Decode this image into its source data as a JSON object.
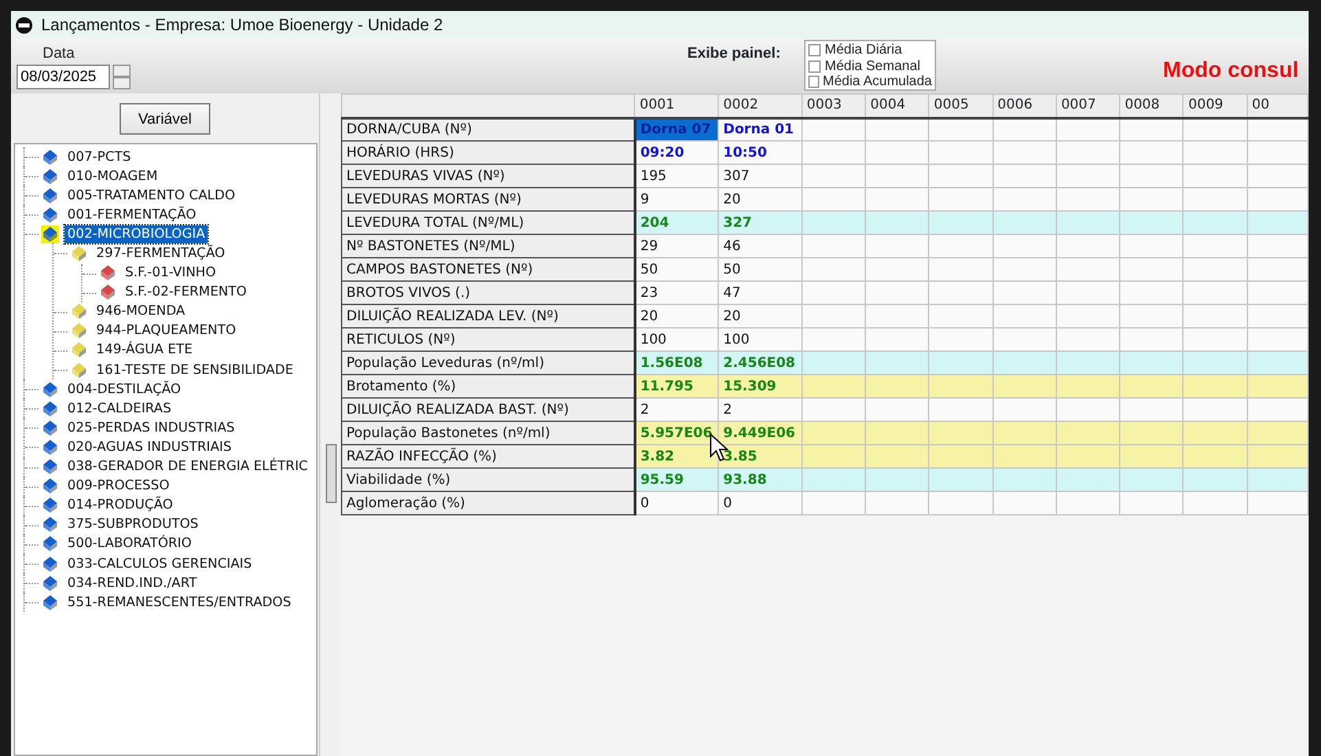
{
  "window": {
    "title": "Lançamentos  -  Empresa: Umoe Bioenergy - Unidade 2"
  },
  "toolbar": {
    "date_label": "Data",
    "date_value": "08/03/2025",
    "panel_label": "Exibe painel:",
    "panels": [
      {
        "label": "Média Diária",
        "checked": false
      },
      {
        "label": "Média Semanal",
        "checked": false
      },
      {
        "label": "Média Acumulada",
        "checked": false
      }
    ],
    "mode": "Modo consul"
  },
  "sidebar": {
    "button": "Variável",
    "items": [
      {
        "label": "007-PCTS",
        "color": "#1560d0",
        "selected": false
      },
      {
        "label": "010-MOAGEM",
        "color": "#1560d0",
        "selected": false
      },
      {
        "label": "005-TRATAMENTO CALDO",
        "color": "#1560d0",
        "selected": false
      },
      {
        "label": "001-FERMENTAÇÃO",
        "color": "#1560d0",
        "selected": false
      },
      {
        "label": "002-MICROBIOLOGIA",
        "color": "#1560d0",
        "selected": true,
        "children": [
          {
            "label": "297-FERMENTAÇÃO",
            "color": "#e2d64a",
            "selected": false,
            "children": [
              {
                "label": "S.F.-01-VINHO",
                "color": "#d84848",
                "selected": false
              },
              {
                "label": "S.F.-02-FERMENTO",
                "color": "#d84848",
                "selected": false
              }
            ]
          },
          {
            "label": "946-MOENDA",
            "color": "#e2d64a",
            "selected": false
          },
          {
            "label": "944-PLAQUEAMENTO",
            "color": "#e2d64a",
            "selected": false
          },
          {
            "label": "149-ÁGUA ETE",
            "color": "#e2d64a",
            "selected": false
          },
          {
            "label": "161-TESTE DE SENSIBILIDADE",
            "color": "#e2d64a",
            "selected": false
          }
        ]
      },
      {
        "label": "004-DESTILAÇÃO",
        "color": "#1560d0",
        "selected": false
      },
      {
        "label": "012-CALDEIRAS",
        "color": "#1560d0",
        "selected": false
      },
      {
        "label": "025-PERDAS INDUSTRIAS",
        "color": "#1560d0",
        "selected": false
      },
      {
        "label": "020-AGUAS INDUSTRIAIS",
        "color": "#1560d0",
        "selected": false
      },
      {
        "label": "038-GERADOR DE ENERGIA ELÉTRIC",
        "color": "#1560d0",
        "selected": false
      },
      {
        "label": "009-PROCESSO",
        "color": "#1560d0",
        "selected": false
      },
      {
        "label": "014-PRODUÇÃO",
        "color": "#1560d0",
        "selected": false
      },
      {
        "label": "375-SUBPRODUTOS",
        "color": "#1560d0",
        "selected": false
      },
      {
        "label": "500-LABORATÓRIO",
        "color": "#1560d0",
        "selected": false
      },
      {
        "label": "033-CALCULOS GERENCIAIS",
        "color": "#1560d0",
        "selected": false
      },
      {
        "label": "034-REND.IND./ART",
        "color": "#1560d0",
        "selected": false
      },
      {
        "label": "551-REMANESCENTES/ENTRADOS",
        "color": "#1560d0",
        "selected": false
      }
    ]
  },
  "table": {
    "columns": [
      "0001",
      "0002",
      "0003",
      "0004",
      "0005",
      "0006",
      "0007",
      "0008",
      "0009",
      "00"
    ],
    "rows": [
      {
        "label": "DORNA/CUBA (Nº)",
        "kind": "info",
        "values": [
          {
            "text": "Dorna 07",
            "selected": true
          },
          {
            "text": "Dorna 01",
            "selected": false
          }
        ]
      },
      {
        "label": "HORÁRIO (HRS)",
        "kind": "info",
        "values": [
          {
            "text": "09:20",
            "selected": false
          },
          {
            "text": "10:50",
            "selected": false
          }
        ]
      },
      {
        "label": "LEVEDURAS VIVAS (Nº)",
        "kind": "input",
        "values": [
          {
            "text": "195",
            "selected": false
          },
          {
            "text": "307",
            "selected": false
          }
        ]
      },
      {
        "label": "LEVEDURAS MORTAS (Nº)",
        "kind": "input",
        "values": [
          {
            "text": "9",
            "selected": false
          },
          {
            "text": "20",
            "selected": false
          }
        ]
      },
      {
        "label": "LEVEDURA TOTAL (Nº/ML)",
        "kind": "total",
        "values": [
          {
            "text": "204",
            "selected": false
          },
          {
            "text": "327",
            "selected": false
          }
        ]
      },
      {
        "label": "Nº BASTONETES (Nº/ML)",
        "kind": "input",
        "values": [
          {
            "text": "29",
            "selected": false
          },
          {
            "text": "46",
            "selected": false
          }
        ]
      },
      {
        "label": "CAMPOS BASTONETES (Nº)",
        "kind": "input",
        "values": [
          {
            "text": "50",
            "selected": false
          },
          {
            "text": "50",
            "selected": false
          }
        ]
      },
      {
        "label": "BROTOS VIVOS (.)",
        "kind": "input",
        "values": [
          {
            "text": "23",
            "selected": false
          },
          {
            "text": "47",
            "selected": false
          }
        ]
      },
      {
        "label": "DILUIÇÃO REALIZADA LEV. (Nº)",
        "kind": "input",
        "values": [
          {
            "text": "20",
            "selected": false
          },
          {
            "text": "20",
            "selected": false
          }
        ]
      },
      {
        "label": "RETICULOS (Nº)",
        "kind": "input",
        "values": [
          {
            "text": "100",
            "selected": false
          },
          {
            "text": "100",
            "selected": false
          }
        ]
      },
      {
        "label": "População Leveduras (nº/ml)",
        "kind": "total",
        "values": [
          {
            "text": "1.56E08",
            "selected": false
          },
          {
            "text": "2.456E08",
            "selected": false
          }
        ]
      },
      {
        "label": "Brotamento (%)",
        "kind": "ratio",
        "values": [
          {
            "text": "11.795",
            "selected": false
          },
          {
            "text": "15.309",
            "selected": false
          }
        ]
      },
      {
        "label": "DILUIÇÃO REALIZADA BAST. (Nº)",
        "kind": "input",
        "values": [
          {
            "text": "2",
            "selected": false
          },
          {
            "text": "2",
            "selected": false
          }
        ]
      },
      {
        "label": "População Bastonetes (nº/ml)",
        "kind": "ratio",
        "values": [
          {
            "text": "5.957E06",
            "selected": false
          },
          {
            "text": "9.449E06",
            "selected": false
          }
        ]
      },
      {
        "label": "RAZÃO INFECÇÃO (%)",
        "kind": "ratio",
        "values": [
          {
            "text": "3.82",
            "selected": false
          },
          {
            "text": "3.85",
            "selected": false
          }
        ]
      },
      {
        "label": "Viabilidade (%)",
        "kind": "total",
        "values": [
          {
            "text": "95.59",
            "selected": false
          },
          {
            "text": "93.88",
            "selected": false
          }
        ]
      },
      {
        "label": "Aglomeração (%)",
        "kind": "input",
        "values": [
          {
            "text": "0",
            "selected": false
          },
          {
            "text": "0",
            "selected": false
          }
        ]
      }
    ]
  }
}
